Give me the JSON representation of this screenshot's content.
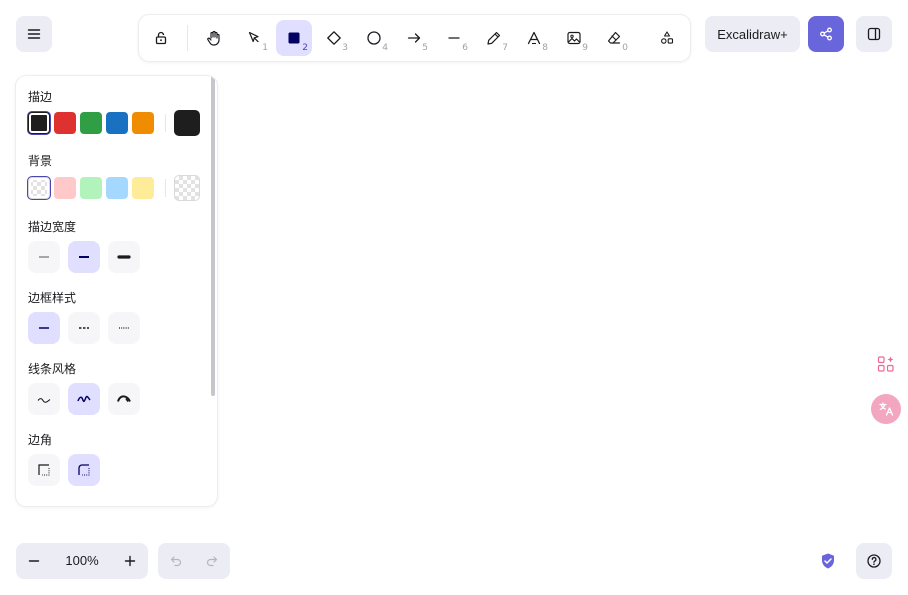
{
  "toolbar": {
    "tools": [
      {
        "name": "lock",
        "num": ""
      },
      {
        "name": "hand",
        "num": ""
      },
      {
        "name": "selection",
        "num": "1"
      },
      {
        "name": "rectangle",
        "num": "2",
        "active": true
      },
      {
        "name": "diamond",
        "num": "3"
      },
      {
        "name": "ellipse",
        "num": "4"
      },
      {
        "name": "arrow",
        "num": "5"
      },
      {
        "name": "line",
        "num": "6"
      },
      {
        "name": "draw",
        "num": "7"
      },
      {
        "name": "text",
        "num": "8"
      },
      {
        "name": "image",
        "num": "9"
      },
      {
        "name": "eraser",
        "num": "0"
      },
      {
        "name": "more-shapes",
        "num": ""
      }
    ],
    "plus_label": "Excalidraw+"
  },
  "panel": {
    "stroke_title": "描边",
    "background_title": "背景",
    "stroke_width_title": "描边宽度",
    "stroke_style_title": "边框样式",
    "sloppiness_title": "线条风格",
    "edges_title": "边角",
    "stroke_colors": [
      "#1e1e1e",
      "#e03131",
      "#2f9e44",
      "#1971c2",
      "#f08c00"
    ],
    "stroke_current": "#1e1e1e",
    "bg_colors": [
      "transparent",
      "#ffc9c9",
      "#b2f2bb",
      "#a5d8ff",
      "#ffec99"
    ],
    "bg_current": "transparent"
  },
  "footer": {
    "zoom_level": "100%"
  },
  "colors": {
    "accent": "#6965db",
    "active_bg": "#e0dfff",
    "button_bg": "#ececf4"
  }
}
